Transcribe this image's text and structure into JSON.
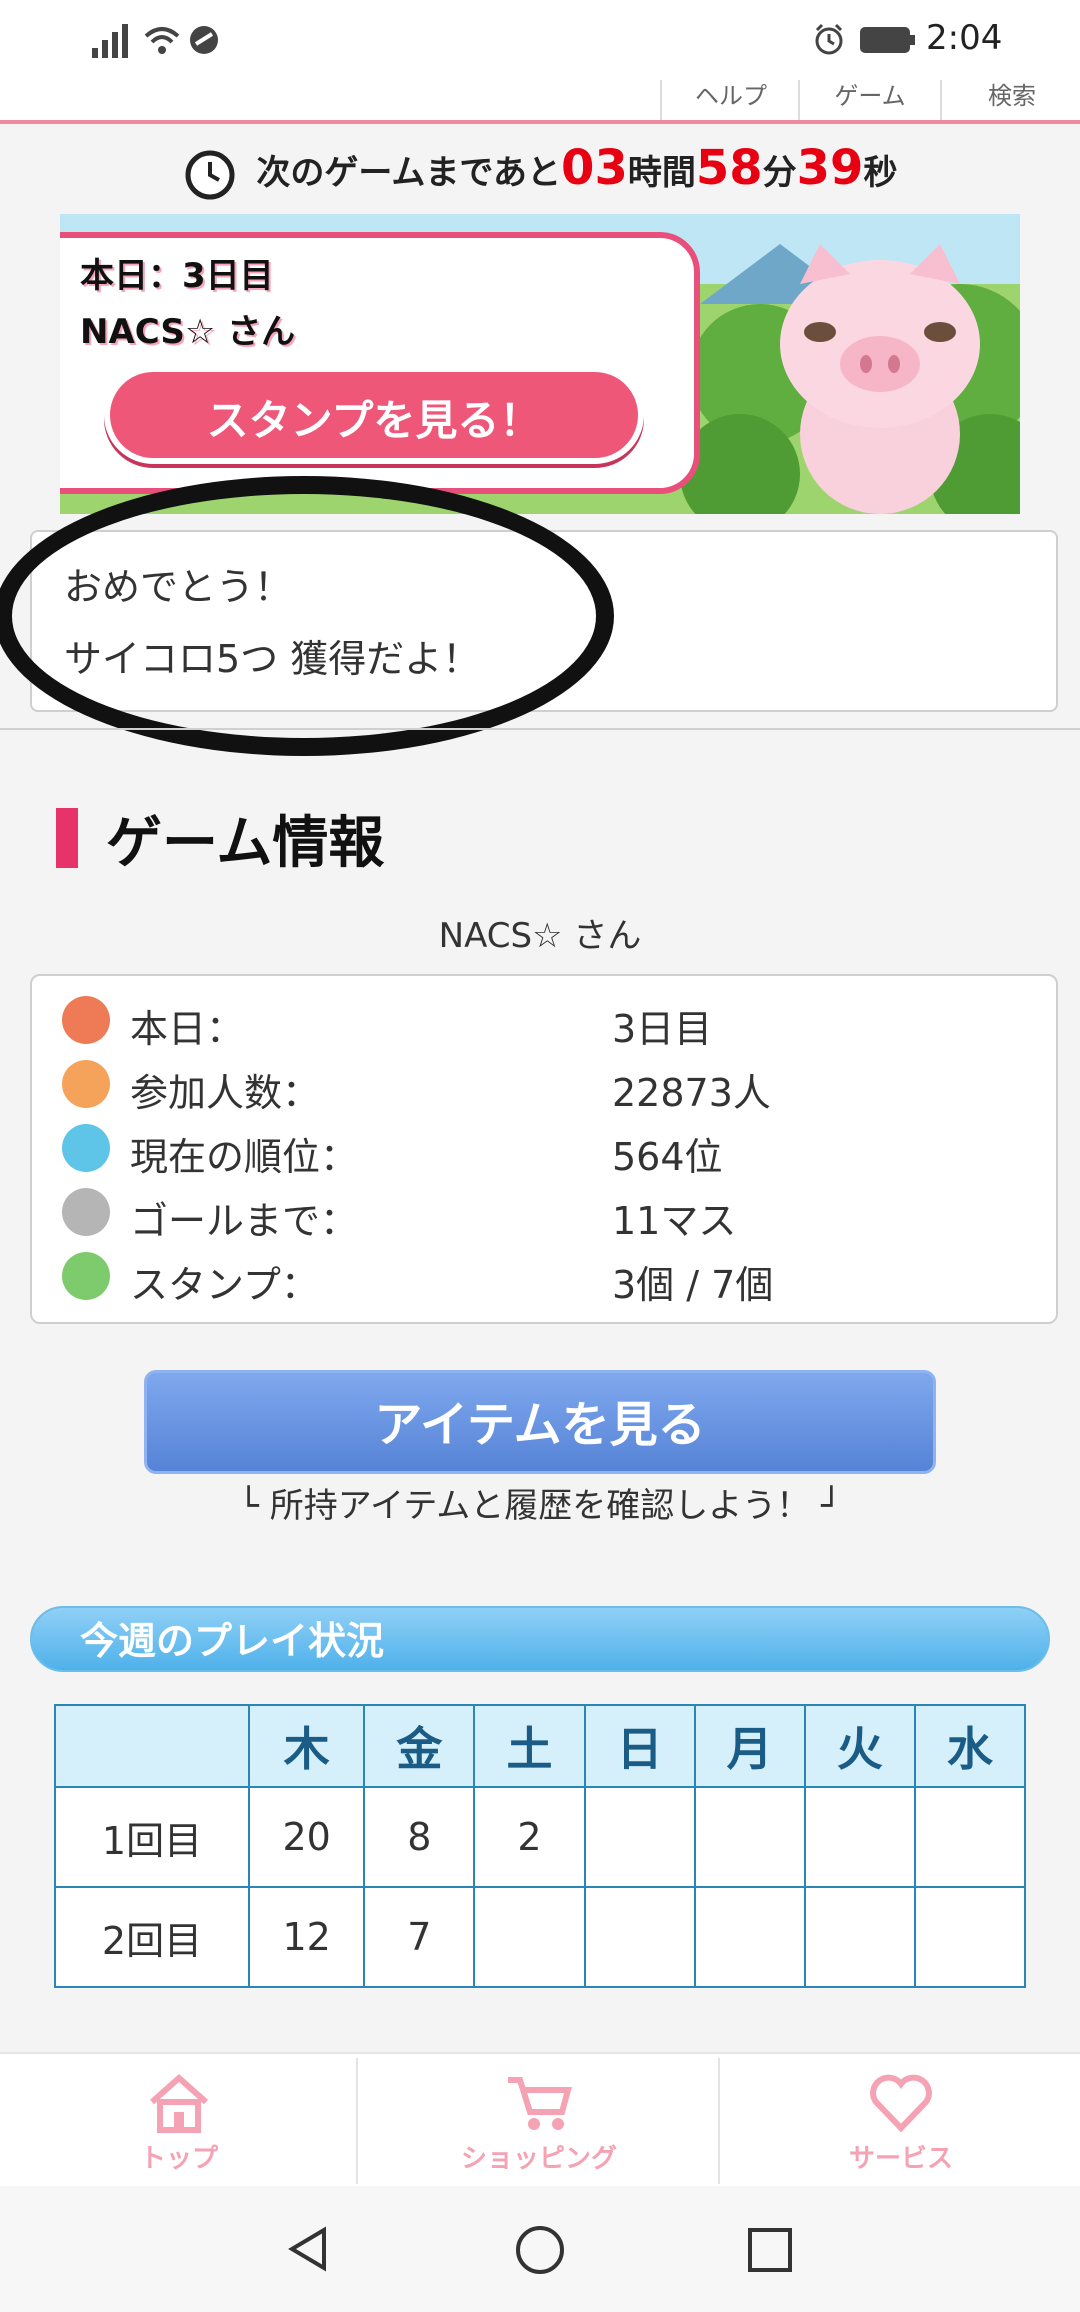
{
  "status_bar": {
    "time": "2:04"
  },
  "top_tabs": [
    "ヘルプ",
    "ゲーム",
    "検索"
  ],
  "countdown": {
    "prefix": "次のゲームまであと",
    "hours": "03",
    "hours_unit": "時間",
    "minutes": "58",
    "minutes_unit": "分",
    "seconds": "39",
    "seconds_unit": "秒"
  },
  "banner": {
    "day": "本日：3日目",
    "user": "NACS☆ さん",
    "button": "スタンプを見る！"
  },
  "message": {
    "line1": "おめでとう！",
    "line2": "サイコロ5つ 獲得だよ！"
  },
  "game_info": {
    "title": "ゲーム情報",
    "username": "NACS☆ さん",
    "rows": [
      {
        "label": "本日：",
        "value": "3日目",
        "icon": "pin-icon",
        "color": "#ee7b55"
      },
      {
        "label": "参加人数：",
        "value": "22873人",
        "icon": "person-icon",
        "color": "#f5a25b"
      },
      {
        "label": "現在の順位：",
        "value": "564位",
        "icon": "flag-icon",
        "color": "#5ec4e8"
      },
      {
        "label": "ゴールまで：",
        "value": "11マス",
        "icon": "checkered-flag-icon",
        "color": "#b5b5b5"
      },
      {
        "label": "スタンプ：",
        "value": "3個 / 7個",
        "icon": "star-icon",
        "color": "#7ecb6e"
      }
    ]
  },
  "item_button": {
    "label": "アイテムを見る",
    "caption": "└ 所持アイテムと履歴を確認しよう！ ┘"
  },
  "weekly": {
    "title": "今週のプレイ状況",
    "days": [
      "木",
      "金",
      "土",
      "日",
      "月",
      "火",
      "水"
    ],
    "rows": [
      {
        "label": "1回目",
        "values": [
          "20",
          "8",
          "2",
          "",
          "",
          "",
          ""
        ]
      },
      {
        "label": "2回目",
        "values": [
          "12",
          "7",
          "",
          "",
          "",
          "",
          ""
        ]
      }
    ]
  },
  "bottom_nav": [
    {
      "label": "トップ",
      "icon": "home-icon"
    },
    {
      "label": "ショッピング",
      "icon": "cart-icon"
    },
    {
      "label": "サービス",
      "icon": "heart-icon"
    }
  ],
  "colors": {
    "accent_pink": "#e6336a",
    "countdown_red": "#e60012",
    "item_button": "#5f8fe0",
    "table_border": "#2b86b8"
  }
}
